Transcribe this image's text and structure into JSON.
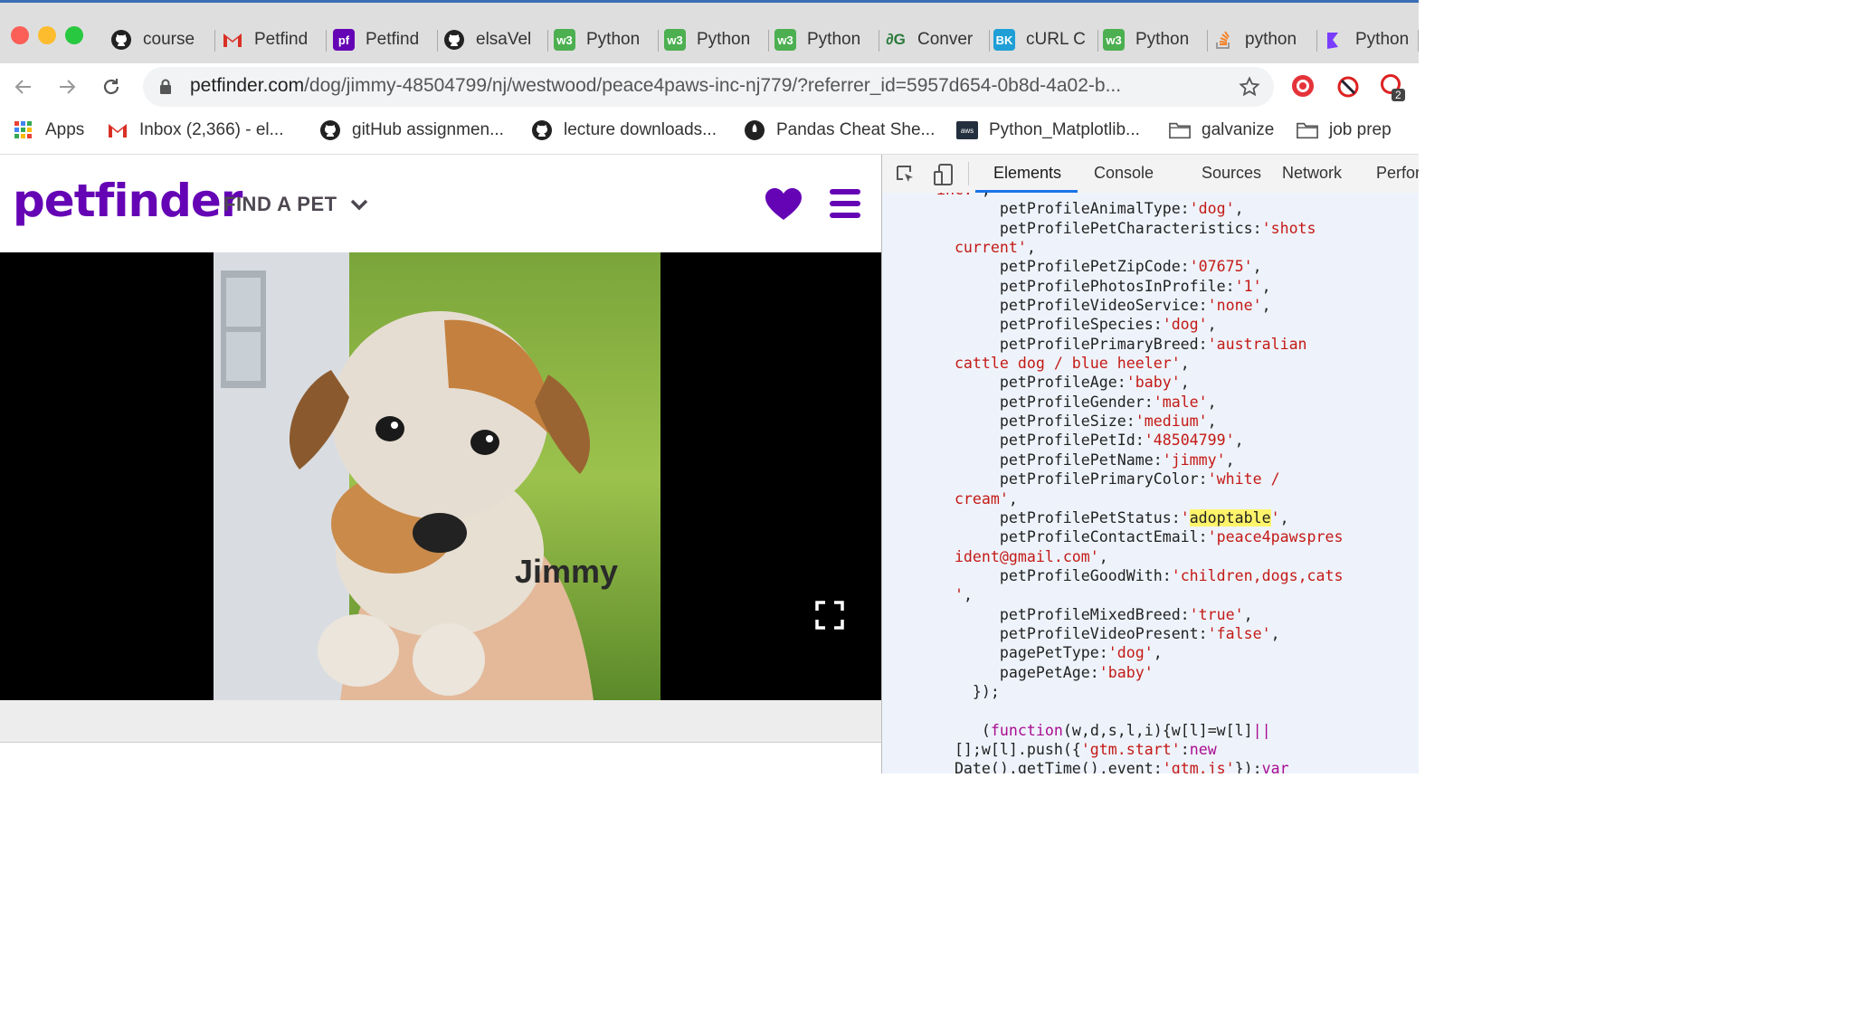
{
  "tabs": [
    {
      "label": "course",
      "icon": "github-icon"
    },
    {
      "label": "Petfind",
      "icon": "gmail-icon"
    },
    {
      "label": "Petfind",
      "icon": "petfinder-icon"
    },
    {
      "label": "elsaVel",
      "icon": "github-icon"
    },
    {
      "label": "Python",
      "icon": "w3schools-icon"
    },
    {
      "label": "Python",
      "icon": "w3schools-icon"
    },
    {
      "label": "Python",
      "icon": "w3schools-icon"
    },
    {
      "label": "Conver",
      "icon": "converter-icon"
    },
    {
      "label": "cURL C",
      "icon": "curl-icon"
    },
    {
      "label": "Python",
      "icon": "w3schools-icon"
    },
    {
      "label": "python",
      "icon": "stackoverflow-icon"
    },
    {
      "label": "Python",
      "icon": "python-docs-icon"
    }
  ],
  "address_bar": {
    "host": "petfinder.com",
    "path": "/dog/jimmy-48504799/nj/westwood/peace4paws-inc-nj779/?referrer_id=5957d654-0b8d-4a02-b..."
  },
  "extensions": {
    "badge_count": "2"
  },
  "bookmarks": [
    {
      "label": "Apps",
      "icon": "apps-grid-icon"
    },
    {
      "label": "Inbox (2,366) - el...",
      "icon": "gmail-icon"
    },
    {
      "label": "gitHub assignmen...",
      "icon": "github-icon"
    },
    {
      "label": "lecture downloads...",
      "icon": "github-icon"
    },
    {
      "label": "Pandas Cheat She...",
      "icon": "rocket-icon"
    },
    {
      "label": "Python_Matplotlib...",
      "icon": "aws-icon"
    },
    {
      "label": "galvanize",
      "icon": "folder-icon"
    },
    {
      "label": "job prep",
      "icon": "folder-icon"
    }
  ],
  "petfinder": {
    "logo": "petfinder",
    "find_a_pet": "FIND A PET",
    "photo_caption": "Jimmy"
  },
  "devtools": {
    "tabs": [
      "Elements",
      "Console",
      "Sources",
      "Network",
      "Perfor"
    ],
    "active_tab": "Elements",
    "code_lines": [
      {
        "indent": "      ",
        "parts": [
          {
            "t": "s",
            "v": "inc.'"
          },
          {
            "t": "k",
            "v": ","
          }
        ]
      },
      {
        "indent": "             ",
        "parts": [
          {
            "t": "k",
            "v": "petProfileAnimalType:"
          },
          {
            "t": "s",
            "v": "'dog'"
          },
          {
            "t": "k",
            "v": ","
          }
        ]
      },
      {
        "indent": "             ",
        "parts": [
          {
            "t": "k",
            "v": "petProfilePetCharacteristics:"
          },
          {
            "t": "s",
            "v": "'shots"
          }
        ]
      },
      {
        "indent": "        ",
        "parts": [
          {
            "t": "s",
            "v": "current'"
          },
          {
            "t": "k",
            "v": ","
          }
        ]
      },
      {
        "indent": "             ",
        "parts": [
          {
            "t": "k",
            "v": "petProfilePetZipCode:"
          },
          {
            "t": "s",
            "v": "'07675'"
          },
          {
            "t": "k",
            "v": ","
          }
        ]
      },
      {
        "indent": "             ",
        "parts": [
          {
            "t": "k",
            "v": "petProfilePhotosInProfile:"
          },
          {
            "t": "s",
            "v": "'1'"
          },
          {
            "t": "k",
            "v": ","
          }
        ]
      },
      {
        "indent": "             ",
        "parts": [
          {
            "t": "k",
            "v": "petProfileVideoService:"
          },
          {
            "t": "s",
            "v": "'none'"
          },
          {
            "t": "k",
            "v": ","
          }
        ]
      },
      {
        "indent": "             ",
        "parts": [
          {
            "t": "k",
            "v": "petProfileSpecies:"
          },
          {
            "t": "s",
            "v": "'dog'"
          },
          {
            "t": "k",
            "v": ","
          }
        ]
      },
      {
        "indent": "             ",
        "parts": [
          {
            "t": "k",
            "v": "petProfilePrimaryBreed:"
          },
          {
            "t": "s",
            "v": "'australian"
          }
        ]
      },
      {
        "indent": "        ",
        "parts": [
          {
            "t": "s",
            "v": "cattle dog / blue heeler'"
          },
          {
            "t": "k",
            "v": ","
          }
        ]
      },
      {
        "indent": "             ",
        "parts": [
          {
            "t": "k",
            "v": "petProfileAge:"
          },
          {
            "t": "s",
            "v": "'baby'"
          },
          {
            "t": "k",
            "v": ","
          }
        ]
      },
      {
        "indent": "             ",
        "parts": [
          {
            "t": "k",
            "v": "petProfileGender:"
          },
          {
            "t": "s",
            "v": "'male'"
          },
          {
            "t": "k",
            "v": ","
          }
        ]
      },
      {
        "indent": "             ",
        "parts": [
          {
            "t": "k",
            "v": "petProfileSize:"
          },
          {
            "t": "s",
            "v": "'medium'"
          },
          {
            "t": "k",
            "v": ","
          }
        ]
      },
      {
        "indent": "             ",
        "parts": [
          {
            "t": "k",
            "v": "petProfilePetId:"
          },
          {
            "t": "s",
            "v": "'48504799'"
          },
          {
            "t": "k",
            "v": ","
          }
        ]
      },
      {
        "indent": "             ",
        "parts": [
          {
            "t": "k",
            "v": "petProfilePetName:"
          },
          {
            "t": "s",
            "v": "'jimmy'"
          },
          {
            "t": "k",
            "v": ","
          }
        ]
      },
      {
        "indent": "             ",
        "parts": [
          {
            "t": "k",
            "v": "petProfilePrimaryColor:"
          },
          {
            "t": "s",
            "v": "'white /"
          }
        ]
      },
      {
        "indent": "        ",
        "parts": [
          {
            "t": "s",
            "v": "cream'"
          },
          {
            "t": "k",
            "v": ","
          }
        ]
      },
      {
        "indent": "             ",
        "parts": [
          {
            "t": "k",
            "v": "petProfilePetStatus:"
          },
          {
            "t": "s",
            "v": "'"
          },
          {
            "t": "hl",
            "v": "adoptable"
          },
          {
            "t": "s",
            "v": "'"
          },
          {
            "t": "k",
            "v": ","
          }
        ]
      },
      {
        "indent": "             ",
        "parts": [
          {
            "t": "k",
            "v": "petProfileContactEmail:"
          },
          {
            "t": "s",
            "v": "'peace4pawspres"
          }
        ]
      },
      {
        "indent": "        ",
        "parts": [
          {
            "t": "s",
            "v": "ident@gmail.com'"
          },
          {
            "t": "k",
            "v": ","
          }
        ]
      },
      {
        "indent": "             ",
        "parts": [
          {
            "t": "k",
            "v": "petProfileGoodWith:"
          },
          {
            "t": "s",
            "v": "'children,dogs,cats"
          }
        ]
      },
      {
        "indent": "        ",
        "parts": [
          {
            "t": "s",
            "v": "'"
          },
          {
            "t": "k",
            "v": ","
          }
        ]
      },
      {
        "indent": "             ",
        "parts": [
          {
            "t": "k",
            "v": "petProfileMixedBreed:"
          },
          {
            "t": "s",
            "v": "'true'"
          },
          {
            "t": "k",
            "v": ","
          }
        ]
      },
      {
        "indent": "             ",
        "parts": [
          {
            "t": "k",
            "v": "petProfileVideoPresent:"
          },
          {
            "t": "s",
            "v": "'false'"
          },
          {
            "t": "k",
            "v": ","
          }
        ]
      },
      {
        "indent": "             ",
        "parts": [
          {
            "t": "k",
            "v": "pagePetType:"
          },
          {
            "t": "s",
            "v": "'dog'"
          },
          {
            "t": "k",
            "v": ","
          }
        ]
      },
      {
        "indent": "             ",
        "parts": [
          {
            "t": "k",
            "v": "pagePetAge:"
          },
          {
            "t": "s",
            "v": "'baby'"
          }
        ]
      },
      {
        "indent": "          ",
        "parts": [
          {
            "t": "k",
            "v": "});"
          }
        ]
      },
      {
        "indent": "",
        "parts": []
      },
      {
        "indent": "           ",
        "parts": [
          {
            "t": "k",
            "v": "("
          },
          {
            "t": "f",
            "v": "function"
          },
          {
            "t": "k",
            "v": "(w,d,s,l,i){w[l]=w[l]"
          },
          {
            "t": "f",
            "v": "||"
          }
        ]
      },
      {
        "indent": "        ",
        "parts": [
          {
            "t": "k",
            "v": "[];w[l].push({"
          },
          {
            "t": "s",
            "v": "'gtm.start'"
          },
          {
            "t": "k",
            "v": ":"
          },
          {
            "t": "f",
            "v": "new"
          }
        ]
      },
      {
        "indent": "        ",
        "parts": [
          {
            "t": "k",
            "v": "Date().getTime(),event:"
          },
          {
            "t": "s",
            "v": "'gtm.js'"
          },
          {
            "t": "k",
            "v": "});"
          },
          {
            "t": "f",
            "v": "var"
          }
        ]
      }
    ]
  },
  "colors": {
    "petfinder_purple": "#6504b5",
    "code_string": "#c41a16",
    "code_keyword": "#aa0d91",
    "highlight": "#fff46a",
    "tab_accent": "#3b6fb5"
  }
}
